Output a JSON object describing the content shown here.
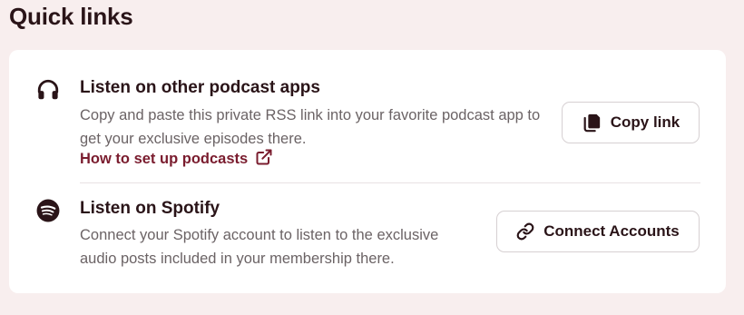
{
  "page": {
    "title": "Quick links"
  },
  "podcast": {
    "icon": "headphones-icon",
    "heading": "Listen on other podcast apps",
    "description": "Copy and paste this private RSS link into your favorite podcast app to get your exclusive episodes there.",
    "link_label": "How to set up podcasts",
    "link_icon": "external-link-icon",
    "button_label": "Copy link",
    "button_icon": "copy-icon"
  },
  "spotify": {
    "icon": "spotify-icon",
    "heading": "Listen on Spotify",
    "description": "Connect your Spotify account to listen to the exclusive audio posts included in your membership there.",
    "button_label": "Connect Accounts",
    "button_icon": "link-icon"
  },
  "colors": {
    "background": "#f8eeee",
    "card": "#ffffff",
    "text": "#2a1418",
    "muted_text": "#6b6365",
    "accent_link": "#7a1c2e",
    "border": "#d6d0d2"
  }
}
